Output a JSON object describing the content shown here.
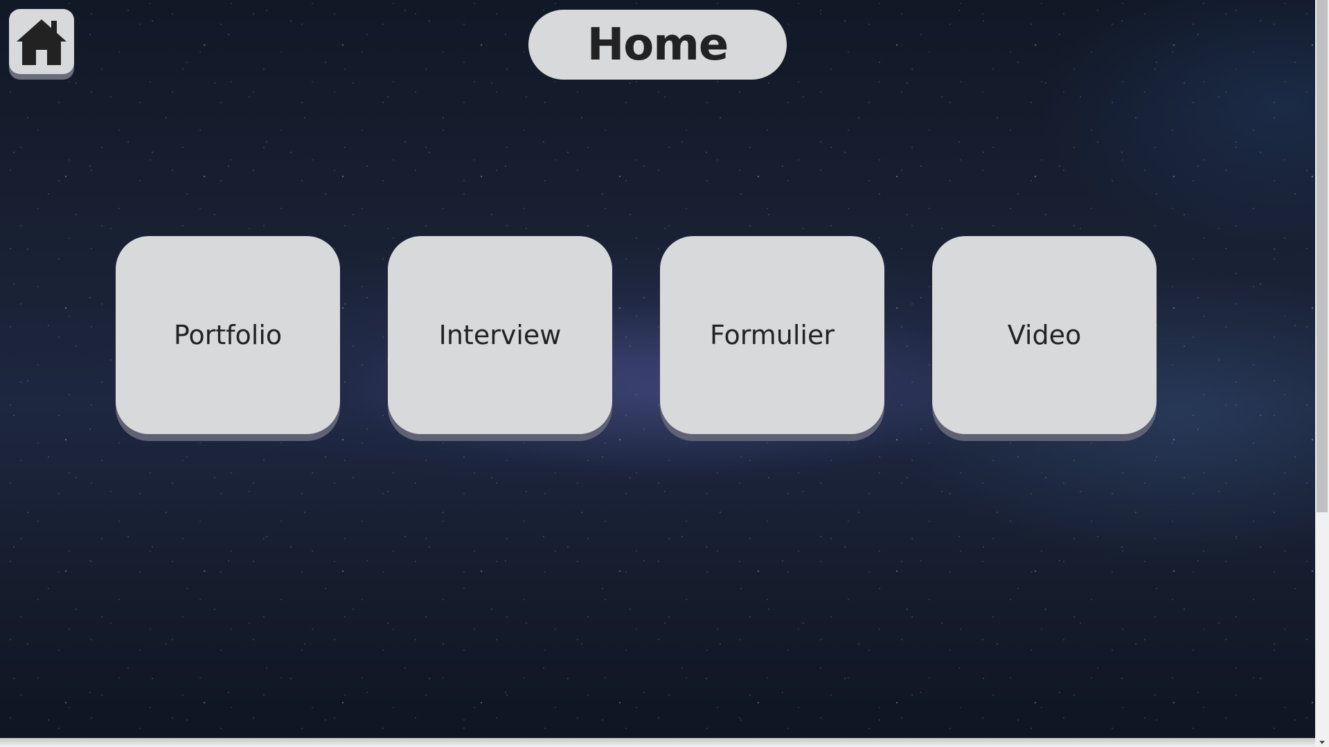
{
  "page": {
    "title": "Home"
  },
  "nav": {
    "home_icon": "house-icon"
  },
  "cards": [
    {
      "label": "Portfolio"
    },
    {
      "label": "Interview"
    },
    {
      "label": "Formulier"
    },
    {
      "label": "Video"
    }
  ],
  "colors": {
    "button_bg": "#d8d9db",
    "button_shadow": "#5e6274",
    "text": "#222222",
    "background": "#131a2a"
  }
}
